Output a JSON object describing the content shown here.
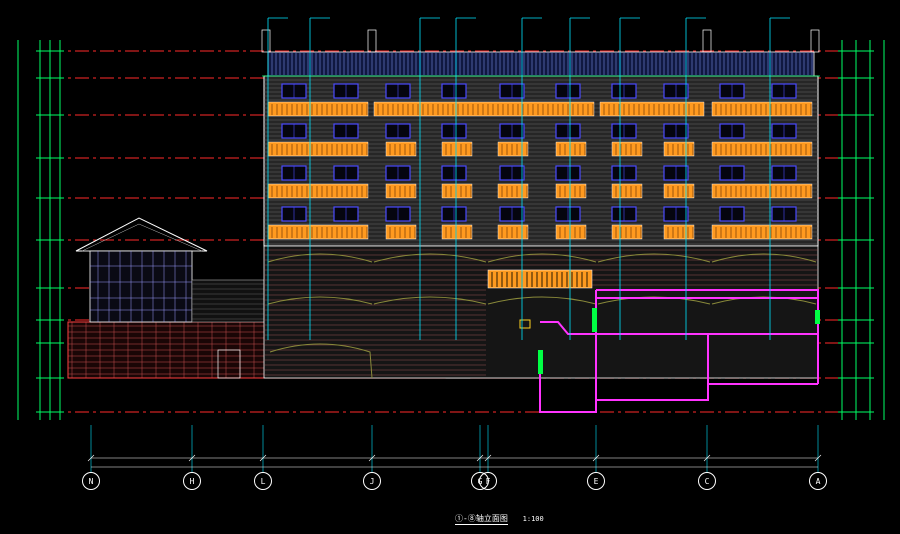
{
  "drawing": {
    "title": "①-⑧轴立面图",
    "scale": "1:100",
    "axes": [
      "N",
      "H",
      "L",
      "J",
      "G",
      "F",
      "E",
      "C",
      "A"
    ],
    "colors": {
      "background": "#000000",
      "grid_line": "#ff2a2a",
      "dimension": "#00ff66",
      "leader": "#00e5ff",
      "balcony": "#ff9a1f",
      "window": "#4a4aff",
      "frame": "#ffffff",
      "section": "#ff33ff",
      "wall_hatch": "#9a9a9a",
      "brick": "#c85050"
    }
  }
}
